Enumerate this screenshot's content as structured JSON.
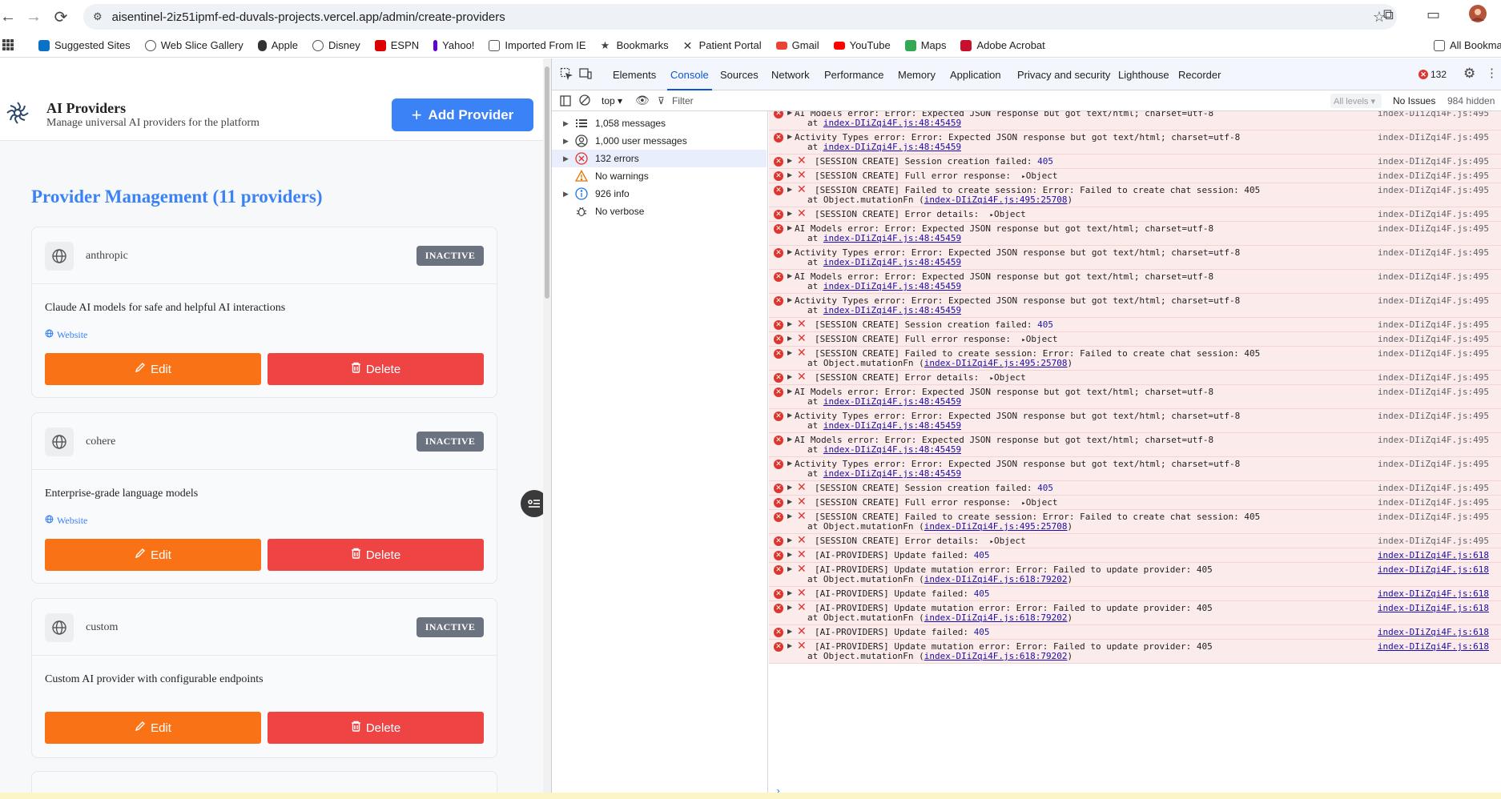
{
  "browser": {
    "url": "aisentinel-2iz51ipmf-ed-duvals-projects.vercel.app/admin/create-providers",
    "bookmarks": [
      "Suggested Sites",
      "Web Slice Gallery",
      "Apple",
      "Disney",
      "ESPN",
      "Yahoo!",
      "Imported From IE",
      "Bookmarks",
      "Patient Portal",
      "Gmail",
      "YouTube",
      "Maps",
      "Adobe Acrobat"
    ],
    "all_bookmarks": "All Bookma"
  },
  "app": {
    "title": "AI Providers",
    "subtitle": "Manage universal AI providers for the platform",
    "add_button": "Add Provider",
    "section_title": "Provider Management (11 providers)",
    "edit_label": "Edit",
    "delete_label": "Delete",
    "website_label": "Website",
    "providers": [
      {
        "name": "anthropic",
        "status": "INACTIVE",
        "description": "Claude AI models for safe and helpful AI interactions",
        "has_website": true
      },
      {
        "name": "cohere",
        "status": "INACTIVE",
        "description": "Enterprise-grade language models",
        "has_website": true
      },
      {
        "name": "custom",
        "status": "INACTIVE",
        "description": "Custom AI provider with configurable endpoints",
        "has_website": false
      }
    ]
  },
  "devtools": {
    "tabs": [
      "Elements",
      "Console",
      "Sources",
      "Network",
      "Performance",
      "Memory",
      "Application",
      "Privacy and security",
      "Lighthouse",
      "Recorder"
    ],
    "active_tab": "Console",
    "error_count": "132",
    "context": "top",
    "filter_placeholder": "Filter",
    "levels": "All levels",
    "issues": "No Issues",
    "hidden": "984 hidden",
    "sidebar": [
      {
        "label": "1,058 messages",
        "icon": "list-icon"
      },
      {
        "label": "1,000 user messages",
        "icon": "user-icon"
      },
      {
        "label": "132 errors",
        "icon": "error-icon"
      },
      {
        "label": "No warnings",
        "icon": "warning-icon"
      },
      {
        "label": "926 info",
        "icon": "info-icon"
      },
      {
        "label": "No verbose",
        "icon": "bug-icon"
      }
    ],
    "messages": [
      {
        "kind": "plain",
        "text": "AI Models error: Error: Expected JSON response but got text/html; charset=utf-8",
        "at": "index-DIiZqi4F.js:48:45459",
        "src": "index-DIiZqi4F.js:495",
        "src_link": false
      },
      {
        "kind": "plain",
        "text": "Activity Types error: Error: Expected JSON response but got text/html; charset=utf-8",
        "at": "index-DIiZqi4F.js:48:45459",
        "src": "index-DIiZqi4F.js:495",
        "src_link": false
      },
      {
        "kind": "x",
        "text": "[SESSION CREATE] Session creation failed: ",
        "num": "405",
        "src": "index-DIiZqi4F.js:495",
        "src_link": false
      },
      {
        "kind": "x",
        "text": "[SESSION CREATE] Full error response:  ",
        "obj": "Object",
        "src": "index-DIiZqi4F.js:495",
        "src_link": false
      },
      {
        "kind": "x",
        "text": "[SESSION CREATE] Failed to create session: Error: Failed to create chat session: 405",
        "fn": "Object.mutationFn",
        "at": "index-DIiZqi4F.js:495:25708",
        "src": "index-DIiZqi4F.js:495",
        "src_link": false
      },
      {
        "kind": "x",
        "text": "[SESSION CREATE] Error details:  ",
        "obj": "Object",
        "src": "index-DIiZqi4F.js:495",
        "src_link": false
      },
      {
        "kind": "plain",
        "text": "AI Models error: Error: Expected JSON response but got text/html; charset=utf-8",
        "at": "index-DIiZqi4F.js:48:45459",
        "src": "index-DIiZqi4F.js:495",
        "src_link": false
      },
      {
        "kind": "plain",
        "text": "Activity Types error: Error: Expected JSON response but got text/html; charset=utf-8",
        "at": "index-DIiZqi4F.js:48:45459",
        "src": "index-DIiZqi4F.js:495",
        "src_link": false
      },
      {
        "kind": "plain",
        "text": "AI Models error: Error: Expected JSON response but got text/html; charset=utf-8",
        "at": "index-DIiZqi4F.js:48:45459",
        "src": "index-DIiZqi4F.js:495",
        "src_link": false
      },
      {
        "kind": "plain",
        "text": "Activity Types error: Error: Expected JSON response but got text/html; charset=utf-8",
        "at": "index-DIiZqi4F.js:48:45459",
        "src": "index-DIiZqi4F.js:495",
        "src_link": false
      },
      {
        "kind": "x",
        "text": "[SESSION CREATE] Session creation failed: ",
        "num": "405",
        "src": "index-DIiZqi4F.js:495",
        "src_link": false
      },
      {
        "kind": "x",
        "text": "[SESSION CREATE] Full error response:  ",
        "obj": "Object",
        "src": "index-DIiZqi4F.js:495",
        "src_link": false
      },
      {
        "kind": "x",
        "text": "[SESSION CREATE] Failed to create session: Error: Failed to create chat session: 405",
        "fn": "Object.mutationFn",
        "at": "index-DIiZqi4F.js:495:25708",
        "src": "index-DIiZqi4F.js:495",
        "src_link": false
      },
      {
        "kind": "x",
        "text": "[SESSION CREATE] Error details:  ",
        "obj": "Object",
        "src": "index-DIiZqi4F.js:495",
        "src_link": false
      },
      {
        "kind": "plain",
        "text": "AI Models error: Error: Expected JSON response but got text/html; charset=utf-8",
        "at": "index-DIiZqi4F.js:48:45459",
        "src": "index-DIiZqi4F.js:495",
        "src_link": false
      },
      {
        "kind": "plain",
        "text": "Activity Types error: Error: Expected JSON response but got text/html; charset=utf-8",
        "at": "index-DIiZqi4F.js:48:45459",
        "src": "index-DIiZqi4F.js:495",
        "src_link": false
      },
      {
        "kind": "plain",
        "text": "AI Models error: Error: Expected JSON response but got text/html; charset=utf-8",
        "at": "index-DIiZqi4F.js:48:45459",
        "src": "index-DIiZqi4F.js:495",
        "src_link": false
      },
      {
        "kind": "plain",
        "text": "Activity Types error: Error: Expected JSON response but got text/html; charset=utf-8",
        "at": "index-DIiZqi4F.js:48:45459",
        "src": "index-DIiZqi4F.js:495",
        "src_link": false
      },
      {
        "kind": "x",
        "text": "[SESSION CREATE] Session creation failed: ",
        "num": "405",
        "src": "index-DIiZqi4F.js:495",
        "src_link": false
      },
      {
        "kind": "x",
        "text": "[SESSION CREATE] Full error response:  ",
        "obj": "Object",
        "src": "index-DIiZqi4F.js:495",
        "src_link": false
      },
      {
        "kind": "x",
        "text": "[SESSION CREATE] Failed to create session: Error: Failed to create chat session: 405",
        "fn": "Object.mutationFn",
        "at": "index-DIiZqi4F.js:495:25708",
        "src": "index-DIiZqi4F.js:495",
        "src_link": false
      },
      {
        "kind": "x",
        "text": "[SESSION CREATE] Error details:  ",
        "obj": "Object",
        "src": "index-DIiZqi4F.js:495",
        "src_link": false
      },
      {
        "kind": "x",
        "text": "[AI-PROVIDERS] Update failed: ",
        "num": "405",
        "src": "index-DIiZqi4F.js:618",
        "src_link": true
      },
      {
        "kind": "x",
        "text": "[AI-PROVIDERS] Update mutation error: Error: Failed to update provider: 405",
        "fn": "Object.mutationFn",
        "at": "index-DIiZqi4F.js:618:79202",
        "src": "index-DIiZqi4F.js:618",
        "src_link": true
      },
      {
        "kind": "x",
        "text": "[AI-PROVIDERS] Update failed: ",
        "num": "405",
        "src": "index-DIiZqi4F.js:618",
        "src_link": true
      },
      {
        "kind": "x",
        "text": "[AI-PROVIDERS] Update mutation error: Error: Failed to update provider: 405",
        "fn": "Object.mutationFn",
        "at": "index-DIiZqi4F.js:618:79202",
        "src": "index-DIiZqi4F.js:618",
        "src_link": true
      },
      {
        "kind": "x",
        "text": "[AI-PROVIDERS] Update failed: ",
        "num": "405",
        "src": "index-DIiZqi4F.js:618",
        "src_link": true
      },
      {
        "kind": "x",
        "text": "[AI-PROVIDERS] Update mutation error: Error: Failed to update provider: 405",
        "fn": "Object.mutationFn",
        "at": "index-DIiZqi4F.js:618:79202",
        "src": "index-DIiZqi4F.js:618",
        "src_link": true
      }
    ]
  }
}
